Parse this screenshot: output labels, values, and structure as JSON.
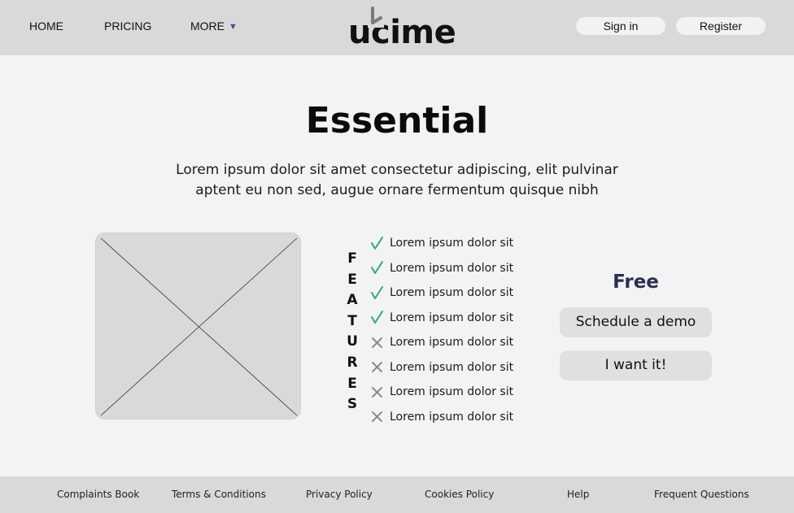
{
  "header": {
    "nav": [
      {
        "label": "HOME"
      },
      {
        "label": "PRICING"
      },
      {
        "label": "MORE",
        "caret": "▼"
      }
    ],
    "logo": "ucime",
    "auth": {
      "sign_in": "Sign in",
      "register": "Register"
    }
  },
  "main": {
    "title": "Essential",
    "subtitle_line1": "Lorem ipsum dolor sit amet consectetur adipiscing, elit pulvinar",
    "subtitle_line2": "aptent eu non sed, augue ornare fermentum quisque nibh",
    "features_label": [
      "F",
      "E",
      "A",
      "T",
      "U",
      "R",
      "E",
      "S"
    ],
    "features": [
      {
        "text": "Lorem ipsum dolor sit",
        "included": true,
        "icon": "check-icon"
      },
      {
        "text": "Lorem ipsum dolor sit",
        "included": true,
        "icon": "check-icon"
      },
      {
        "text": "Lorem ipsum dolor sit",
        "included": true,
        "icon": "check-icon"
      },
      {
        "text": "Lorem ipsum dolor sit",
        "included": true,
        "icon": "check-icon"
      },
      {
        "text": "Lorem ipsum dolor sit",
        "included": false,
        "icon": "cross-icon"
      },
      {
        "text": "Lorem ipsum dolor sit",
        "included": false,
        "icon": "cross-icon"
      },
      {
        "text": "Lorem ipsum dolor sit",
        "included": false,
        "icon": "cross-icon"
      },
      {
        "text": "Lorem ipsum dolor sit",
        "included": false,
        "icon": "cross-icon"
      }
    ],
    "plan_name": "Free",
    "schedule_demo": "Schedule a demo",
    "want_it": "I want it!"
  },
  "footer": {
    "links": [
      {
        "label": "Complaints Book"
      },
      {
        "label": "Terms & Conditions"
      },
      {
        "label": "Privacy Policy"
      },
      {
        "label": "Cookies Policy"
      },
      {
        "label": "Help"
      },
      {
        "label": "Frequent Questions"
      }
    ]
  },
  "colors": {
    "check": "#3aa57a",
    "cross": "#8a8a8a",
    "header_bg": "#d9d9d9",
    "plan_name": "#2e2e4f",
    "caret": "#4b4a8f"
  }
}
